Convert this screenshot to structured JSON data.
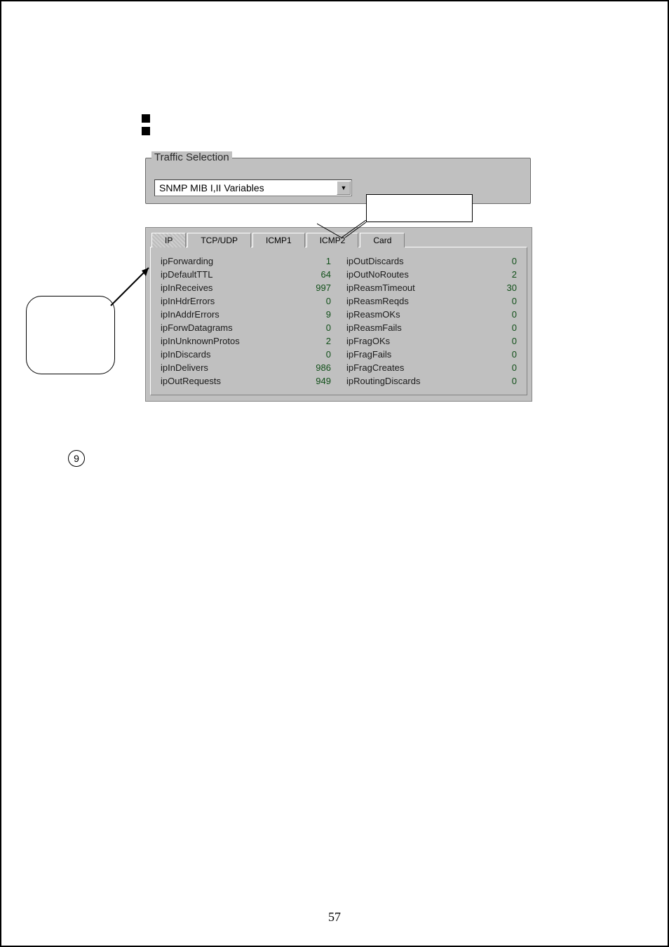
{
  "bullets": [
    "",
    ""
  ],
  "groupbox_title": "Traffic Selection",
  "combo_value": "SNMP MIB I,II Variables",
  "tabs": {
    "t0": "IP",
    "t1": "TCP/UDP",
    "t2": "ICMP1",
    "t3": "ICMP2",
    "t4": "Card"
  },
  "left_rows": [
    {
      "name": "ipForwarding",
      "value": "1"
    },
    {
      "name": "ipDefaultTTL",
      "value": "64"
    },
    {
      "name": "ipInReceives",
      "value": "997"
    },
    {
      "name": "ipInHdrErrors",
      "value": "0"
    },
    {
      "name": "ipInAddrErrors",
      "value": "9"
    },
    {
      "name": "ipForwDatagrams",
      "value": "0"
    },
    {
      "name": "ipInUnknownProtos",
      "value": "2"
    },
    {
      "name": "ipInDiscards",
      "value": "0"
    },
    {
      "name": "ipInDelivers",
      "value": "986"
    },
    {
      "name": "ipOutRequests",
      "value": "949"
    }
  ],
  "right_rows": [
    {
      "name": "ipOutDiscards",
      "value": "0"
    },
    {
      "name": "ipOutNoRoutes",
      "value": "2"
    },
    {
      "name": "ipReasmTimeout",
      "value": "30"
    },
    {
      "name": "ipReasmReqds",
      "value": "0"
    },
    {
      "name": "ipReasmOKs",
      "value": "0"
    },
    {
      "name": "ipReasmFails",
      "value": "0"
    },
    {
      "name": "ipFragOKs",
      "value": "0"
    },
    {
      "name": "ipFragFails",
      "value": "0"
    },
    {
      "name": "ipFragCreates",
      "value": "0"
    },
    {
      "name": "ipRoutingDiscards",
      "value": "0"
    }
  ],
  "step_number": "9",
  "page_number": "57"
}
